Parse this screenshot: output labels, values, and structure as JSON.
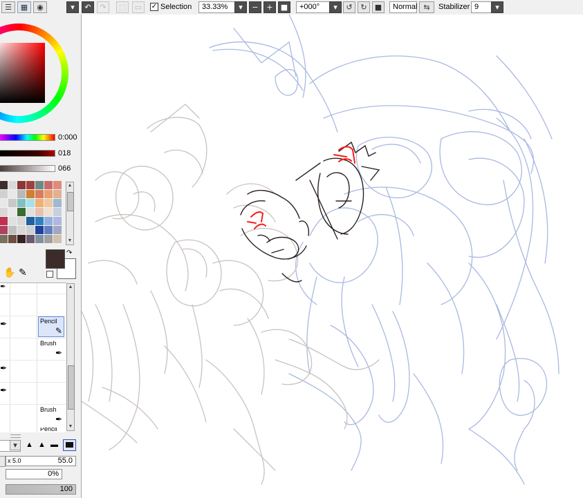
{
  "toolbar": {
    "selection_label": "Selection",
    "selection_checked": "✓",
    "zoom": "33.33%",
    "rotation": "+000°",
    "blend_mode": "Normal",
    "stabilizer_label": "Stabilizer",
    "stabilizer_value": "9"
  },
  "color_panel": {
    "hue_value": "0:000",
    "saturation_value": "018",
    "value_value": "066",
    "primary_color": "#3b2b2b",
    "secondary_color": "#ffffff"
  },
  "swatches": [
    "#3d2e2e",
    "#d9d9d9",
    "#8c3535",
    "#a14040",
    "#6b8b84",
    "#c96b6b",
    "#e08a7a",
    "#d0d0d0",
    "#e8e8e8",
    "#b8b8b8",
    "#cf8030",
    "#d87c60",
    "#e8a070",
    "#e0b090",
    "#e8e8e8",
    "#c8c8c8",
    "#80c0c0",
    "#a8e0e8",
    "#f0b070",
    "#f0c8a0",
    "#a0b8d0",
    "#d8d8d8",
    "#e8e8e8",
    "#3b6b30",
    "#e0e0e0",
    "#e8c0b0",
    "#f0e0d0",
    "#c8d0e0",
    "#c03050",
    "#e0e0e0",
    "#d8d8d8",
    "#2060a0",
    "#3080c0",
    "#90b0e0",
    "#b0b8e0",
    "#b04060",
    "#c0c0c0",
    "#d8d8d8",
    "#d0d0d0",
    "#2040a0",
    "#6080c0",
    "#a0a8c0",
    "#7a7060",
    "#6b5040",
    "#3a2020",
    "#6a5a70",
    "#8090a0",
    "#a0a0a0",
    "#d0c0b0"
  ],
  "tools": {
    "pencil_label": "Pencil",
    "brush_label_1": "Brush",
    "brush_label_2": "Brush",
    "pencil_label_2": "Pencil"
  },
  "brush_settings": {
    "size_multiplier": "x 5.0",
    "size_value": "55.0",
    "min_size": "0%",
    "density": "100"
  }
}
